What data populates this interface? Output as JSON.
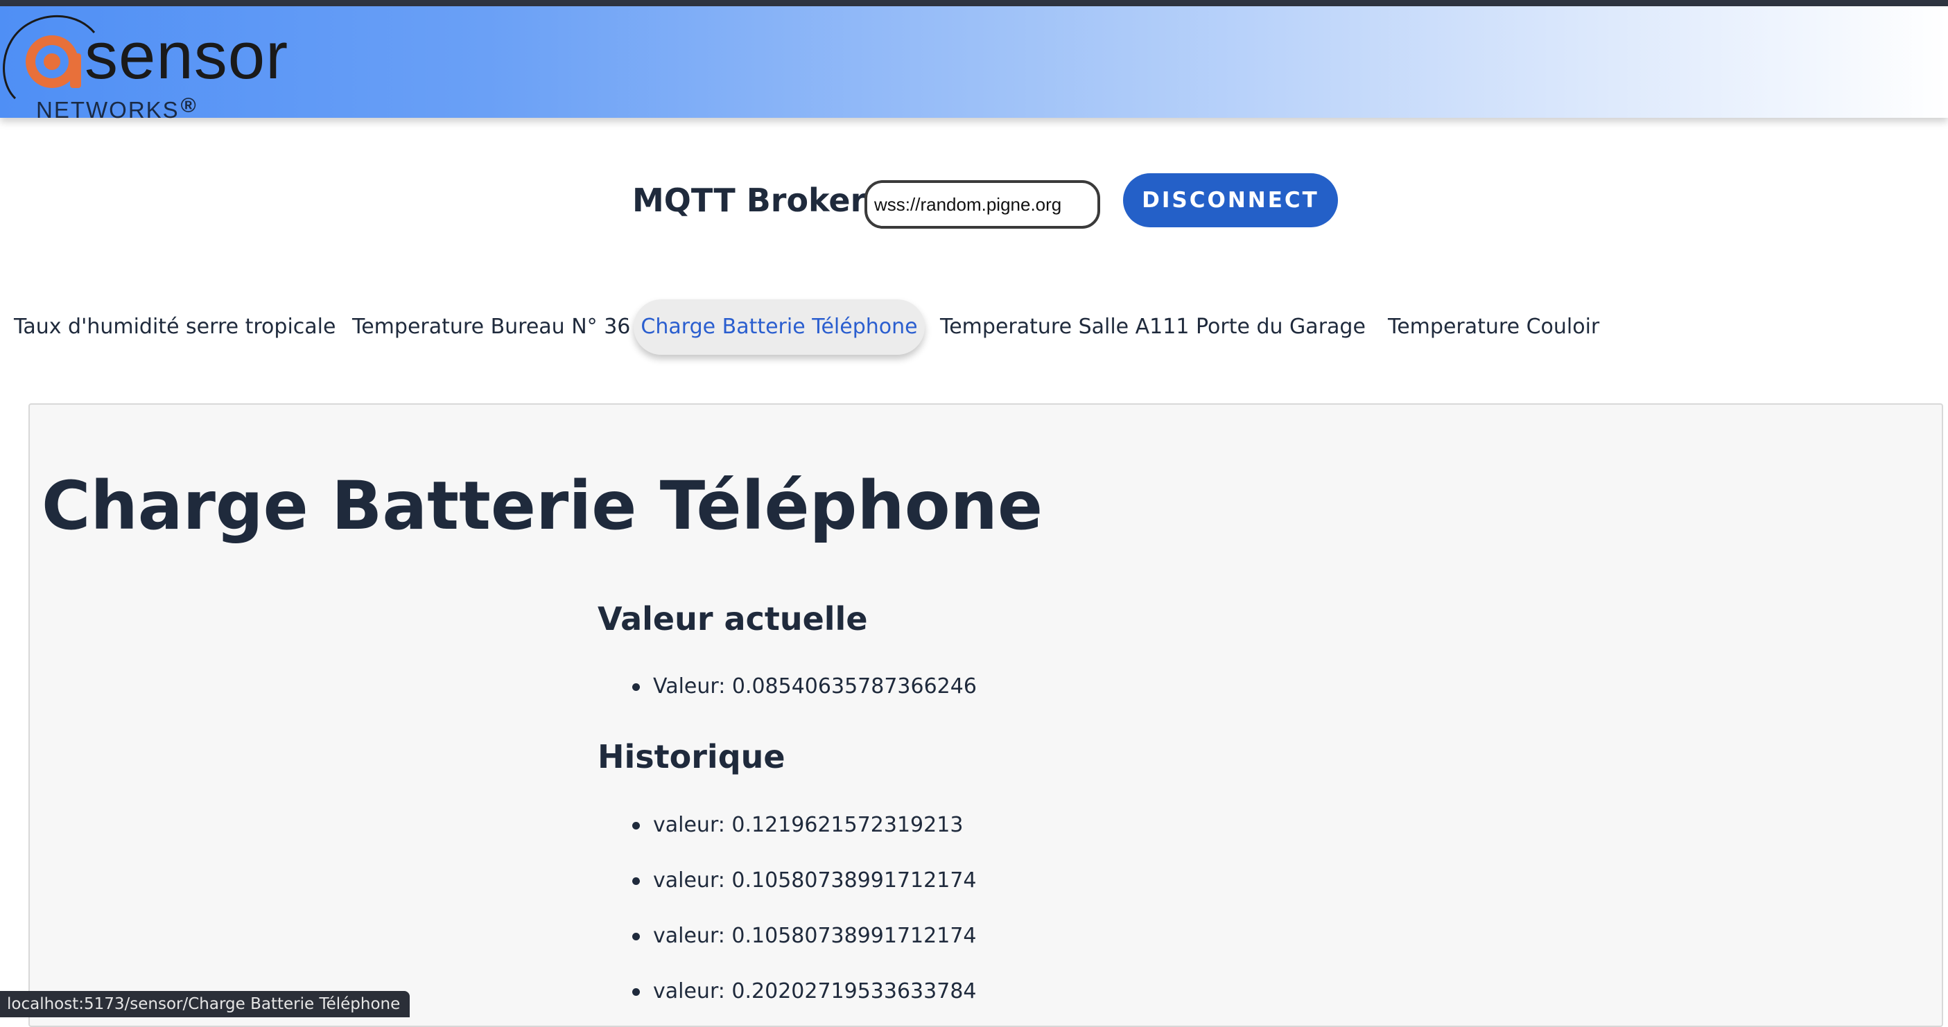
{
  "logo": {
    "word": "sensor",
    "sub": "NETWORKS",
    "reg": "®"
  },
  "broker": {
    "label": "MQTT Broker:",
    "value": "wss://random.pigne.org",
    "button": "DISCONNECT"
  },
  "tabs": [
    {
      "label": "Taux d'humidité serre tropicale",
      "active": false
    },
    {
      "label": "Temperature Bureau N° 36",
      "active": false
    },
    {
      "label": "Charge Batterie Téléphone",
      "active": true
    },
    {
      "label": "Temperature Salle A111",
      "active": false
    },
    {
      "label": "Porte du Garage",
      "active": false
    },
    {
      "label": "Temperature Couloir",
      "active": false
    }
  ],
  "sensor": {
    "title": "Charge Batterie Téléphone",
    "current_heading": "Valeur actuelle",
    "current_value": "Valeur: 0.08540635787366246",
    "history_heading": "Historique",
    "history": [
      "valeur: 0.1219621572319213",
      "valeur: 0.10580738991712174",
      "valeur: 0.10580738991712174",
      "valeur: 0.20202719533633784"
    ]
  },
  "status_url": "localhost:5173/sensor/Charge Batterie Téléphone",
  "colors": {
    "accent": "#2460c8",
    "active_tab_text": "#2a5ecf",
    "text": "#1f2a3c",
    "logo_orange": "#e8703a"
  }
}
